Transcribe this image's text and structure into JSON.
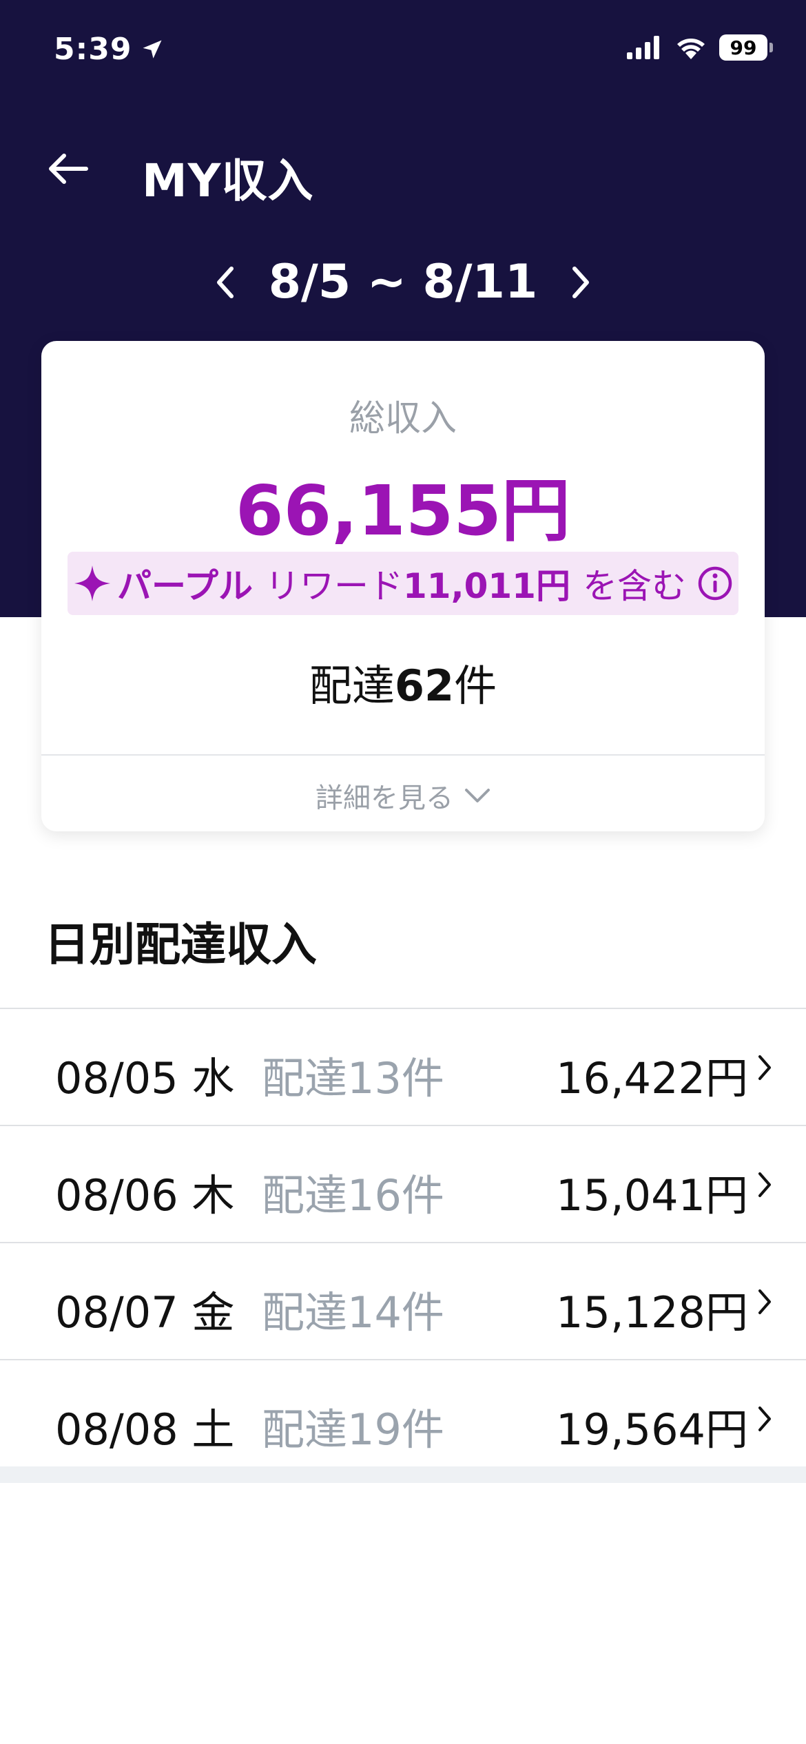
{
  "status_bar": {
    "time": "5:39",
    "battery": "99"
  },
  "header": {
    "title": "MY収入",
    "week_range": "8/5 ~ 8/11"
  },
  "summary": {
    "total_label": "総収入",
    "total_amount": "66,155円",
    "reward": {
      "brand": "パープル",
      "label": "リワード",
      "amount": "11,011円",
      "suffix": "を含む"
    },
    "deliveries_prefix": "配達",
    "deliveries_count": "62",
    "deliveries_suffix": "件",
    "details_label": "詳細を見る"
  },
  "daily": {
    "title": "日別配達収入",
    "rows": [
      {
        "date": "08/05 水",
        "count": "配達13件",
        "amount": "16,422円"
      },
      {
        "date": "08/06 木",
        "count": "配達16件",
        "amount": "15,041円"
      },
      {
        "date": "08/07 金",
        "count": "配達14件",
        "amount": "15,128円"
      },
      {
        "date": "08/08 土",
        "count": "配達19件",
        "amount": "19,564円"
      }
    ]
  },
  "colors": {
    "header_bg": "#17123f",
    "accent": "#9b14b4",
    "reward_bg": "#f5e6f7",
    "muted": "#9aa0a8"
  },
  "icons": [
    "location-arrow-icon",
    "signal-icon",
    "wifi-icon",
    "battery-icon",
    "back-arrow-icon",
    "chevron-left-icon",
    "chevron-right-icon",
    "sparkle-icon",
    "info-icon",
    "chevron-down-icon"
  ]
}
